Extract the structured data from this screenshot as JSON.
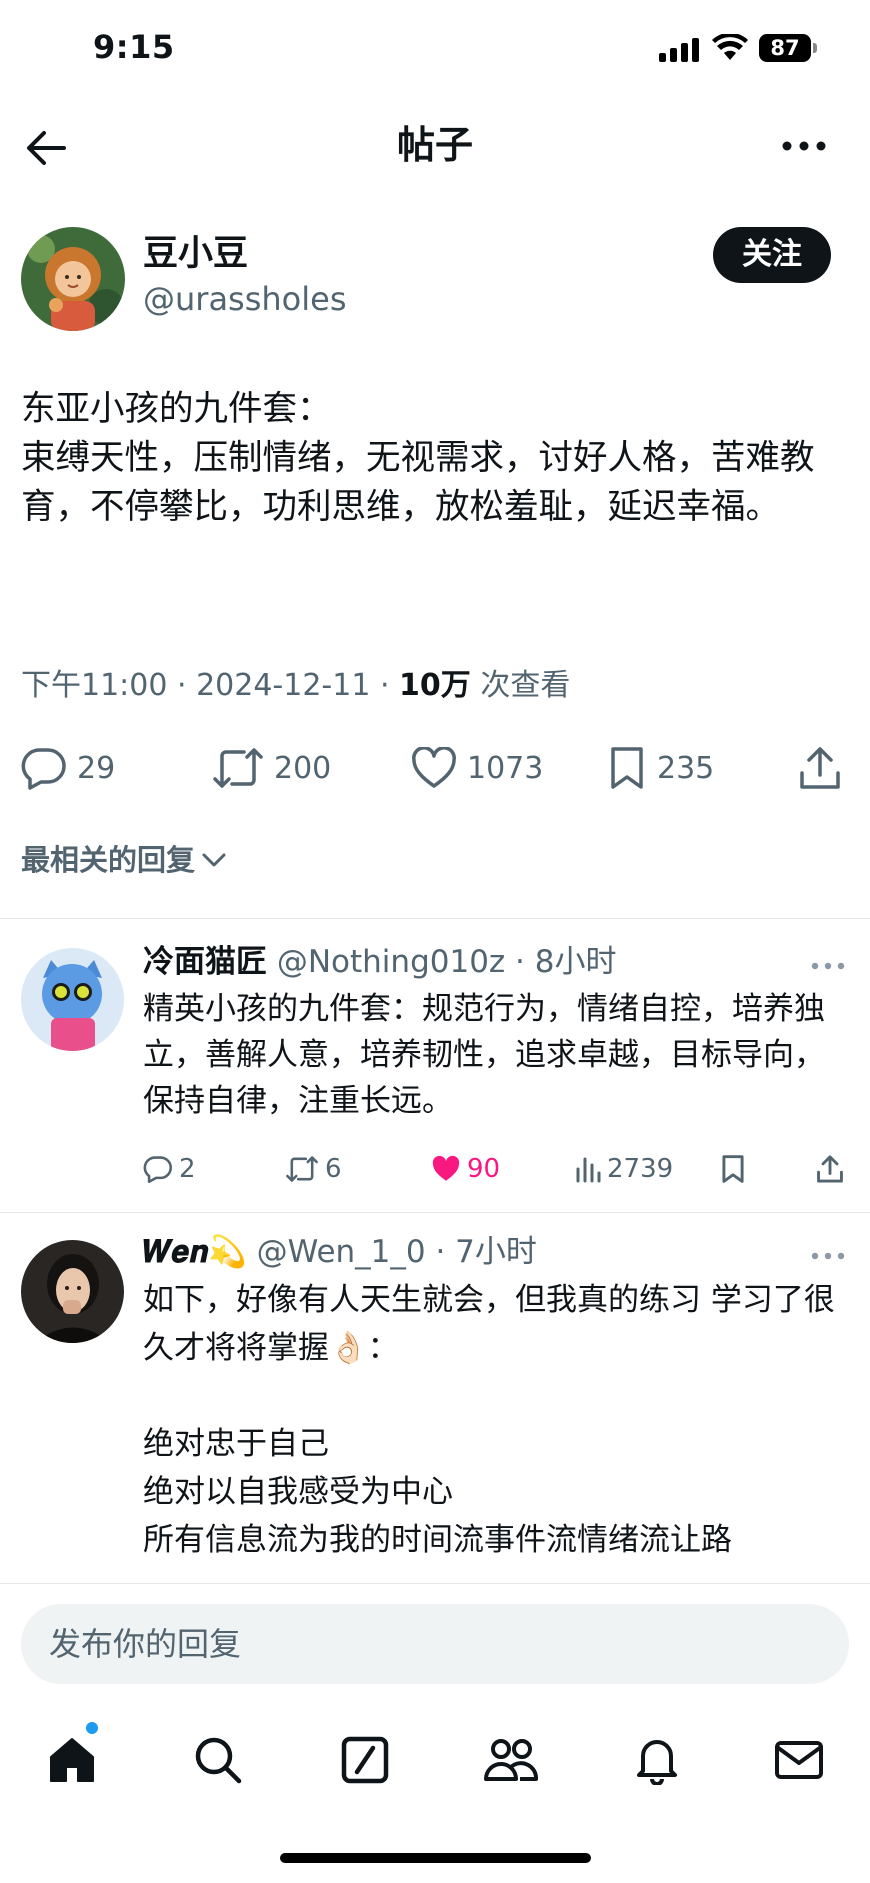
{
  "status_bar": {
    "time": "9:15",
    "battery": "87"
  },
  "header": {
    "title": "帖子",
    "icons": [
      "back-arrow-icon",
      "more-icon"
    ]
  },
  "post": {
    "author_name": "豆小豆",
    "author_handle": "@urassholes",
    "follow_label": "关注",
    "text": "东亚小孩的九件套：\n束缚天性，压制情绪，无视需求，讨好人格，苦难教育，不停攀比，功利思维，放松羞耻，延迟幸福。",
    "meta_prefix": "下午11:00 · 2024-12-11 · ",
    "views_count": "10万",
    "views_suffix": " 次查看",
    "replies": "29",
    "reposts": "200",
    "likes": "1073",
    "bookmarks": "235"
  },
  "sort_label": "最相关的回复",
  "replies": [
    {
      "name": "冷面猫匠",
      "meta": " @Nothing010z · 8小时",
      "text": "精英小孩的九件套：规范行为，情绪自控，培养独立，善解人意，培养韧性，追求卓越，目标导向，保持自律，注重长远。",
      "replies": "2",
      "reposts": "6",
      "likes": "90",
      "views": "2739",
      "liked": true
    },
    {
      "name": "𝑾𝒆𝒏💫",
      "meta": " @Wen_1_0 · 7小时",
      "text": "如下，好像有人天生就会，但我真的练习 学习了很久才将将掌握👌🏻：\n\n绝对忠于自己\n绝对以自我感受为中心\n所有信息流为我的时间流事件流情绪流让路"
    }
  ],
  "composer": {
    "placeholder": "发布你的回复"
  },
  "colors": {
    "text": "#0f1419",
    "secondary": "#536471",
    "like": "#f91880",
    "accent": "#1d9bf0"
  }
}
